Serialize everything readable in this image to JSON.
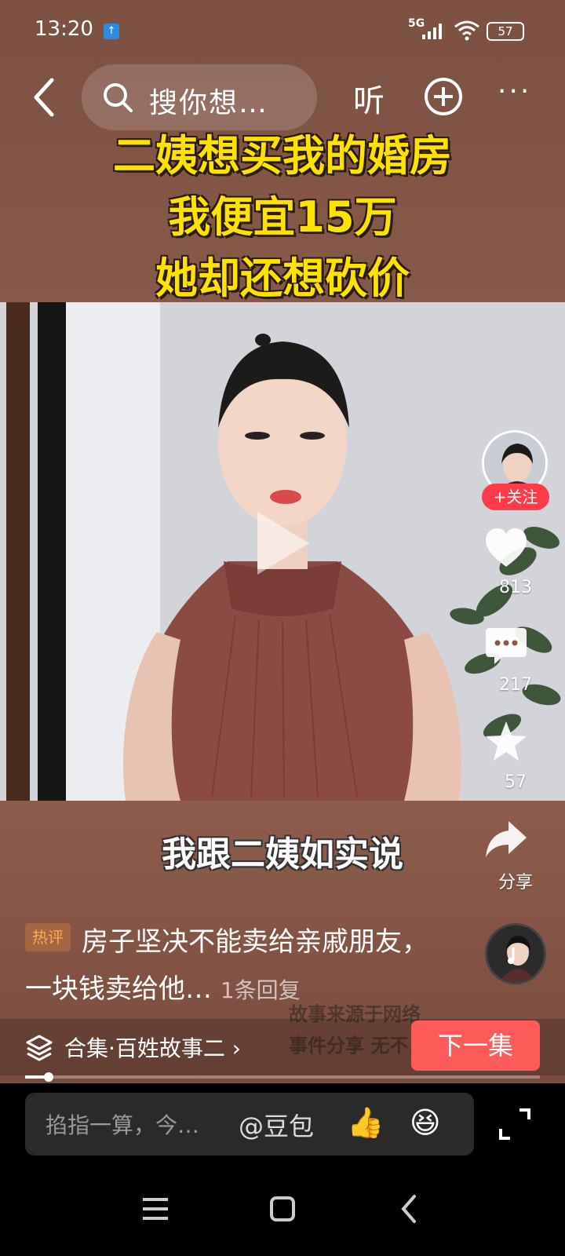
{
  "status": {
    "time": "13:20",
    "network": "5G",
    "battery": "57"
  },
  "nav": {
    "search_placeholder": "搜你想…",
    "listen": "听"
  },
  "video": {
    "headline": [
      "二姨想买我的婚房",
      "我便宜15万",
      "她却还想砍价"
    ],
    "subtitle": "我跟二姨如实说",
    "watermark": [
      "故事来源于网络",
      "事件分享 无不良"
    ]
  },
  "rail": {
    "follow": "+关注",
    "likes": "813",
    "comments": "217",
    "favorites": "57",
    "share": "分享"
  },
  "hot_comment": {
    "badge": "热评",
    "text": "房子坚决不能卖给亲戚朋友，一块钱卖给他…",
    "replies": "1条回复"
  },
  "collection": {
    "label": "合集·百姓故事二 ›",
    "next": "下一集",
    "progress": 0.045
  },
  "input": {
    "placeholder": "掐指一算，今…",
    "mention": "@豆包",
    "emoji1": "👍",
    "emoji2": "😆"
  },
  "colors": {
    "accent": "#fe5a5a",
    "headline": "#ffe200",
    "follow": "#ff3b4a"
  }
}
